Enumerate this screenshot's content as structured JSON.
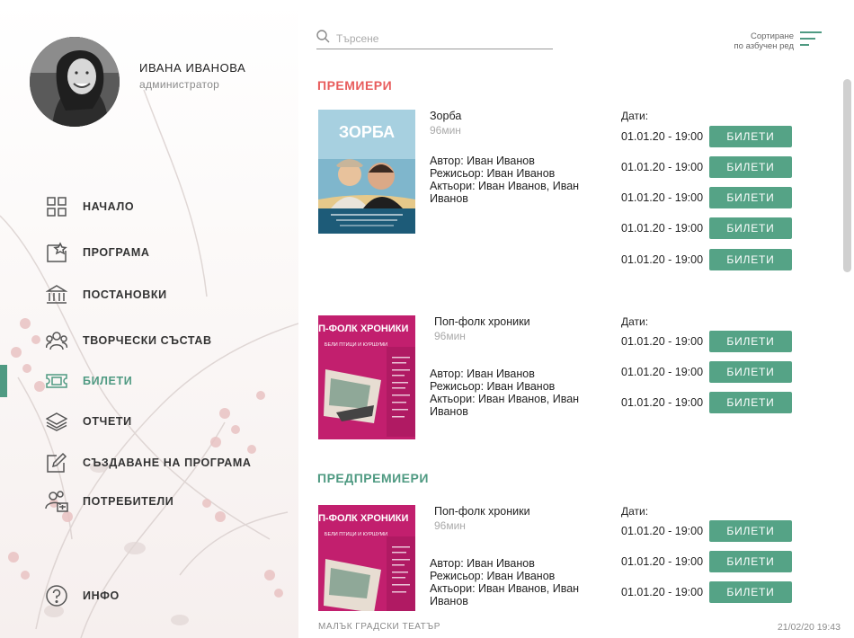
{
  "user": {
    "name": "ИВАНА ИВАНОВА",
    "role": "администратор"
  },
  "nav": {
    "items": [
      {
        "label": "НАЧАЛО"
      },
      {
        "label": "ПРОГРАМА"
      },
      {
        "label": "ПОСТАНОВКИ"
      },
      {
        "label": "ТВОРЧЕСКИ СЪСТАВ"
      },
      {
        "label": "БИЛЕТИ"
      },
      {
        "label": "ОТЧЕТИ"
      },
      {
        "label": "СЪЗДАВАНЕ НА ПРОГРАМА"
      },
      {
        "label": "ПОТРЕБИТЕЛИ"
      }
    ],
    "info": "ИНФО",
    "active": "БИЛЕТИ"
  },
  "search": {
    "placeholder": "Търсене",
    "value": ""
  },
  "sort": {
    "line1": "Сортиране",
    "line2": "по азбучен ред"
  },
  "colors": {
    "accent": "#55a386",
    "premiere": "#e85c5c",
    "prepremiere": "#4f9a82"
  },
  "sections": [
    {
      "title": "ПРЕМИЕРИ",
      "plays": [
        {
          "title": "Зорба",
          "duration": "96мин",
          "poster_title": "ЗОРБА",
          "author": "Автор: Иван Иванов",
          "director": "Режисьор: Иван Иванов",
          "actors": "Актьори: Иван Иванов, Иван Иванов",
          "dates_label": "Дати:",
          "dates": [
            "01.01.20 - 19:00",
            "01.01.20 - 19:00",
            "01.01.20 - 19:00",
            "01.01.20 - 19:00",
            "01.01.20 - 19:00"
          ]
        },
        {
          "title": "Поп-фолк хроники",
          "duration": "96мин",
          "poster_title": "ПОП-ФОЛК ХРОНИКИ",
          "poster_subtitle": "БЕЛИ ПТИЦИ И КУРШУМИ",
          "author": "Автор: Иван Иванов",
          "director": "Режисьор: Иван Иванов",
          "actors": "Актьори: Иван Иванов, Иван Иванов",
          "dates_label": "Дати:",
          "dates": [
            "01.01.20 - 19:00",
            "01.01.20 - 19:00",
            "01.01.20 - 19:00"
          ]
        }
      ]
    },
    {
      "title": "ПРЕДПРЕМИЕРИ",
      "plays": [
        {
          "title": "Поп-фолк хроники",
          "duration": "96мин",
          "poster_title": "ПОП-ФОЛК ХРОНИКИ",
          "poster_subtitle": "БЕЛИ ПТИЦИ И КУРШУМИ",
          "author": "Автор: Иван Иванов",
          "director": "Режисьор: Иван Иванов",
          "actors": "Актьори: Иван Иванов, Иван Иванов",
          "dates_label": "Дати:",
          "dates": [
            "01.01.20 - 19:00",
            "01.01.20 - 19:00",
            "01.01.20 - 19:00"
          ]
        }
      ]
    }
  ],
  "ticket_button_label": "БИЛЕТИ",
  "footer": {
    "theatre": "МАЛЪК ГРАДСКИ ТЕАТЪР",
    "datetime": "21/02/20 19:43"
  }
}
